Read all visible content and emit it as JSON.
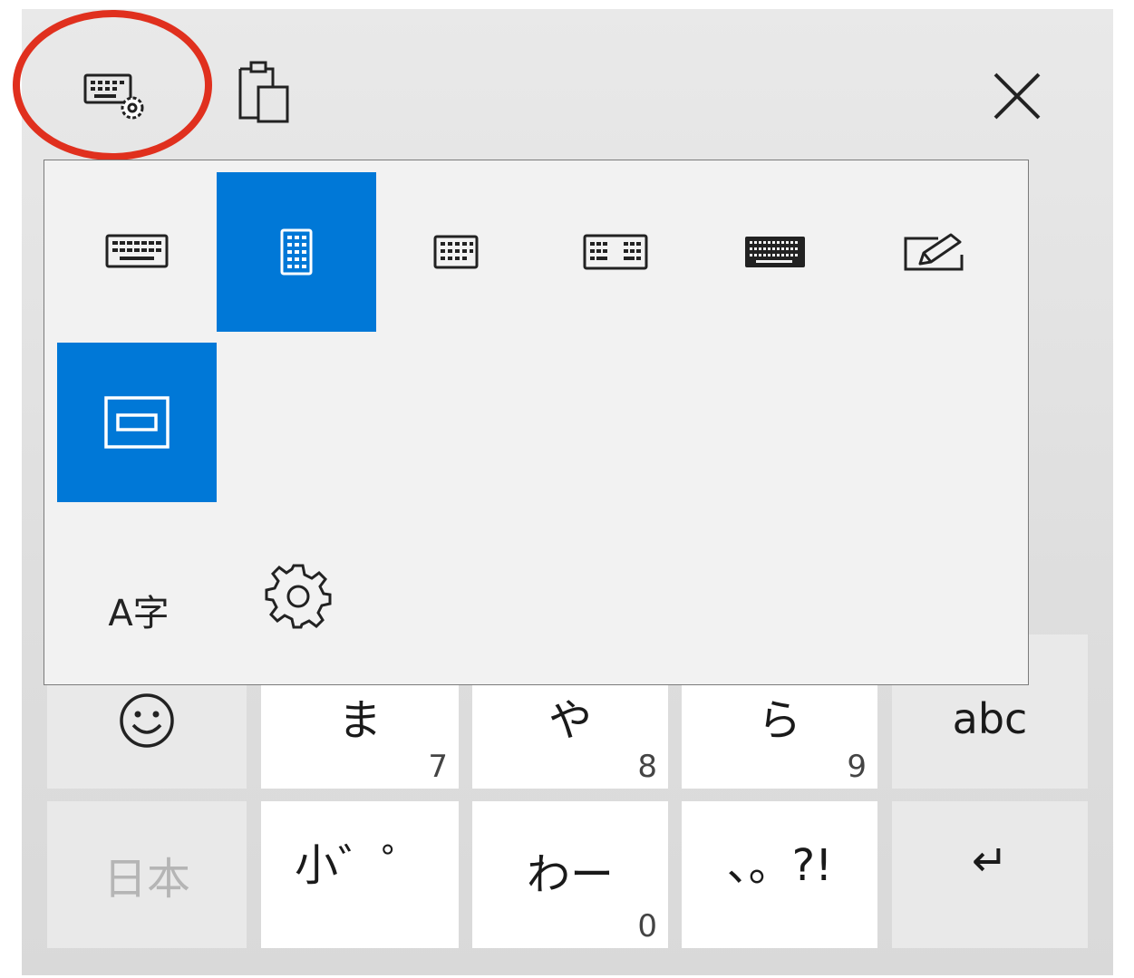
{
  "toolbar": {
    "icons": [
      "keyboard-settings-icon",
      "clipboard-icon",
      "close-icon"
    ]
  },
  "layout_options": [
    {
      "name": "default-keyboard-icon",
      "selected": false
    },
    {
      "name": "one-handed-keyboard-icon",
      "selected": true
    },
    {
      "name": "small-keyboard-icon",
      "selected": false
    },
    {
      "name": "split-keyboard-icon",
      "selected": false
    },
    {
      "name": "full-keyboard-icon",
      "selected": false
    },
    {
      "name": "handwriting-icon",
      "selected": false
    },
    {
      "name": "docked-keyboard-icon",
      "selected": true
    }
  ],
  "panel_bottom": {
    "ime_icon_text": "A字",
    "settings_icon": "gear-icon"
  },
  "keys": {
    "ma": {
      "label": "ま",
      "num": "7"
    },
    "ya": {
      "label": "や",
      "num": "8"
    },
    "ra": {
      "label": "ら",
      "num": "9"
    },
    "abc": {
      "label": "abc"
    },
    "lang": {
      "label": "日本"
    },
    "small": {
      "label": "小゛゜"
    },
    "wa": {
      "label": "わー",
      "num": "0"
    },
    "punct": {
      "label": "、。?!"
    },
    "enter": {
      "label": "↵"
    }
  },
  "colors": {
    "accent": "#0078d7",
    "highlight": "#e0301e"
  }
}
